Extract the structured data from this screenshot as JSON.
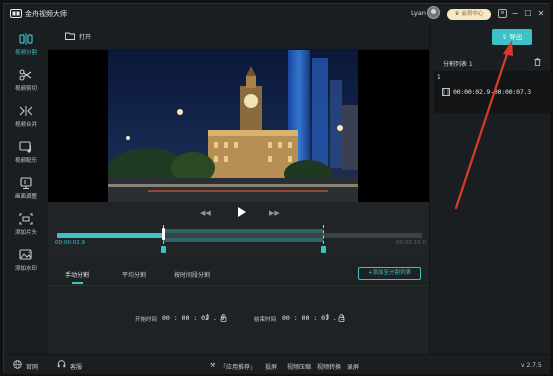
{
  "app": {
    "title": "金舟视频大师",
    "user": "Lyan",
    "vip_label": "会员中心"
  },
  "window_buttons": [
    "menu",
    "minimize",
    "maximize",
    "close"
  ],
  "sidebar": {
    "items": [
      {
        "label": "视频分割",
        "icon": "split-icon",
        "active": true
      },
      {
        "label": "视频剪切",
        "icon": "scissors-icon",
        "active": false
      },
      {
        "label": "视频合并",
        "icon": "merge-icon",
        "active": false
      },
      {
        "label": "视频配乐",
        "icon": "music-icon",
        "active": false
      },
      {
        "label": "画面调整",
        "icon": "adjust-icon",
        "active": false
      },
      {
        "label": "添加片头",
        "icon": "intro-icon",
        "active": false
      },
      {
        "label": "添加水印",
        "icon": "watermark-icon",
        "active": false
      }
    ]
  },
  "toolbar": {
    "open_label": "打开"
  },
  "player": {
    "current_time": "00:00:02.9",
    "end_time": "00:00:10.0",
    "progress": 0.29,
    "segment_start_fraction": 0.29,
    "segment_end_fraction": 0.73
  },
  "panel": {
    "tabs": [
      {
        "label": "手动分割",
        "active": true
      },
      {
        "label": "平均分割",
        "active": false
      },
      {
        "label": "按时间段分割",
        "active": false
      }
    ],
    "add_all_label": "+添加至分割列表",
    "start_label": "开始时间",
    "start_value": "00 : 00 : 02 . 9",
    "end_label": "结束时间",
    "end_value": "00 : 00 : 07 . 3"
  },
  "right_panel": {
    "export_label": "导出",
    "list_title": "分割列表 1",
    "segments": [
      {
        "index": "1",
        "range": "00:00:02.9-00:00:07.3"
      }
    ]
  },
  "bottom": {
    "website_label": "官网",
    "support_label": "客服",
    "recommend_label": "「应用推荐」",
    "links": [
      "投屏",
      "视频压缩",
      "视频转换",
      "录屏"
    ],
    "version": "v 2.7.5"
  },
  "colors": {
    "accent": "#3cc3c7",
    "annotation_arrow": "#d93a2b"
  }
}
